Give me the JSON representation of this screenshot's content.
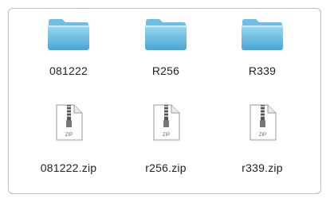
{
  "items": [
    {
      "name": "081222",
      "type": "folder"
    },
    {
      "name": "R256",
      "type": "folder"
    },
    {
      "name": "R339",
      "type": "folder"
    },
    {
      "name": "081222.zip",
      "type": "zip"
    },
    {
      "name": "r256.zip",
      "type": "zip"
    },
    {
      "name": "r339.zip",
      "type": "zip"
    }
  ],
  "zip_badge": "ZIP",
  "colors": {
    "folder_light": "#8fd0ee",
    "folder_dark": "#4fa9d6",
    "border": "#bdbdbd"
  }
}
